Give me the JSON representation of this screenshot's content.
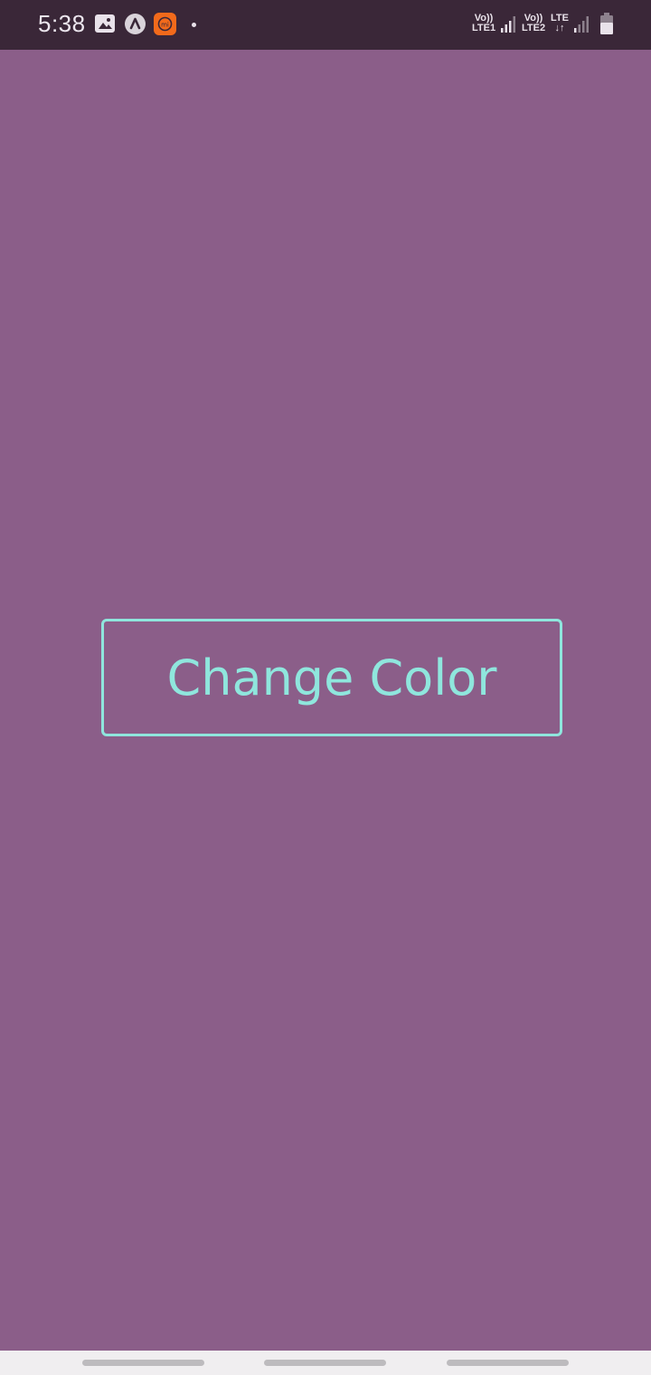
{
  "status_bar": {
    "time": "5:38",
    "icons": [
      "gallery-icon",
      "app-a-icon",
      "mi-icon",
      "notification-dot-icon",
      "signal-icon",
      "battery-icon"
    ],
    "net1": {
      "line1": "Vo))",
      "line2": "LTE1"
    },
    "net2": {
      "line1": "Vo))",
      "line2": "LTE2"
    },
    "net3": {
      "line1": "LTE",
      "line2": "↓↑"
    }
  },
  "main": {
    "button_label": "Change Color"
  },
  "colors": {
    "background": "#8b5e89",
    "status_bar": "#3a2738",
    "accent": "#8fe6dd",
    "nav_bar": "#f0eef0"
  },
  "nav": {
    "handles": 3
  }
}
